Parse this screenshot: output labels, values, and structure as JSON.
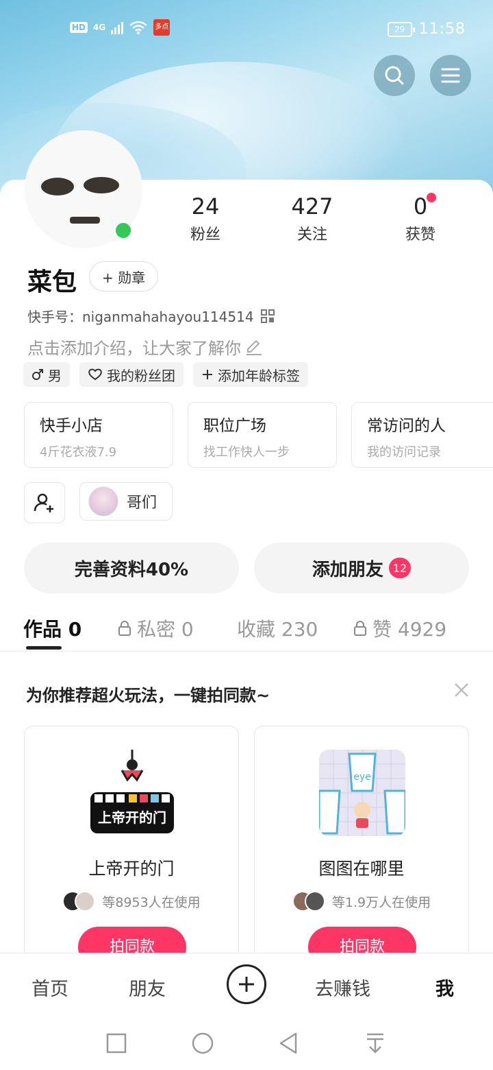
{
  "statusbar": {
    "hd": "HD",
    "network": "4G",
    "app_badge": "多点",
    "battery": "29",
    "time": "11:58"
  },
  "header": {
    "search_icon": "search-icon",
    "menu_icon": "menu-icon"
  },
  "profile": {
    "stats": [
      {
        "num": "24",
        "label": "粉丝"
      },
      {
        "num": "427",
        "label": "关注"
      },
      {
        "num": "0",
        "label": "获赞"
      }
    ],
    "name": "菜包",
    "badge_btn": "+ 勋章",
    "kuaishou_id": "快手号：niganmahahayou114514",
    "intro": "点击添加介绍，让大家了解你",
    "tags": [
      "男",
      "我的粉丝团",
      "添加年龄标签"
    ]
  },
  "services": [
    {
      "title": "快手小店",
      "sub": "4斤花衣液7.9"
    },
    {
      "title": "职位广场",
      "sub": "找工作快人一步"
    },
    {
      "title": "常访问的人",
      "sub": "我的访问记录"
    }
  ],
  "group": {
    "label": "哥们"
  },
  "actions": {
    "complete": "完善资料40%",
    "add_friend": "添加朋友",
    "add_friend_badge": "12"
  },
  "tabs": [
    {
      "label": "作品 0",
      "locked": false
    },
    {
      "label": "私密 0",
      "locked": true
    },
    {
      "label": "收藏 230",
      "locked": false
    },
    {
      "label": "赞 4929",
      "locked": true
    }
  ],
  "recommend": {
    "title": "为你推荐超火玩法，一键拍同款~",
    "cards": [
      {
        "title": "上帝开的门",
        "icon_text": "上帝开的门",
        "users": "等8953人在使用",
        "cta": "拍同款"
      },
      {
        "title": "图图在哪里",
        "icon_text": "eye",
        "users": "等1.9万人在使用",
        "cta": "拍同款"
      }
    ]
  },
  "bottom_nav": {
    "items": [
      "首页",
      "朋友",
      "去赚钱",
      "我"
    ]
  },
  "colors": {
    "accent": "#fe3666",
    "online": "#34c759"
  }
}
